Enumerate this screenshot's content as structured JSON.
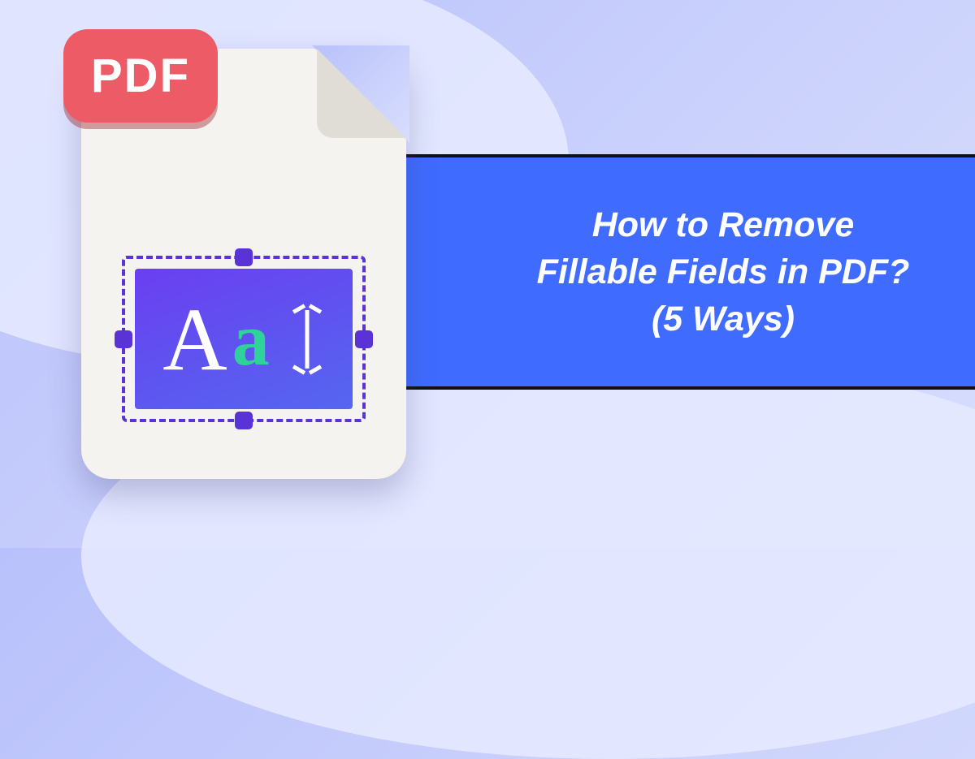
{
  "badge": {
    "label": "PDF"
  },
  "field": {
    "glyph_upper": "A",
    "glyph_lower": "a"
  },
  "banner": {
    "line1": "How to Remove",
    "line2": "Fillable Fields in PDF?",
    "line3": "(5 Ways)"
  },
  "colors": {
    "banner_bg": "#3f6bff",
    "badge_bg": "#ed5c66",
    "selection": "#5a33d6",
    "accent_green": "#2fd39a"
  }
}
